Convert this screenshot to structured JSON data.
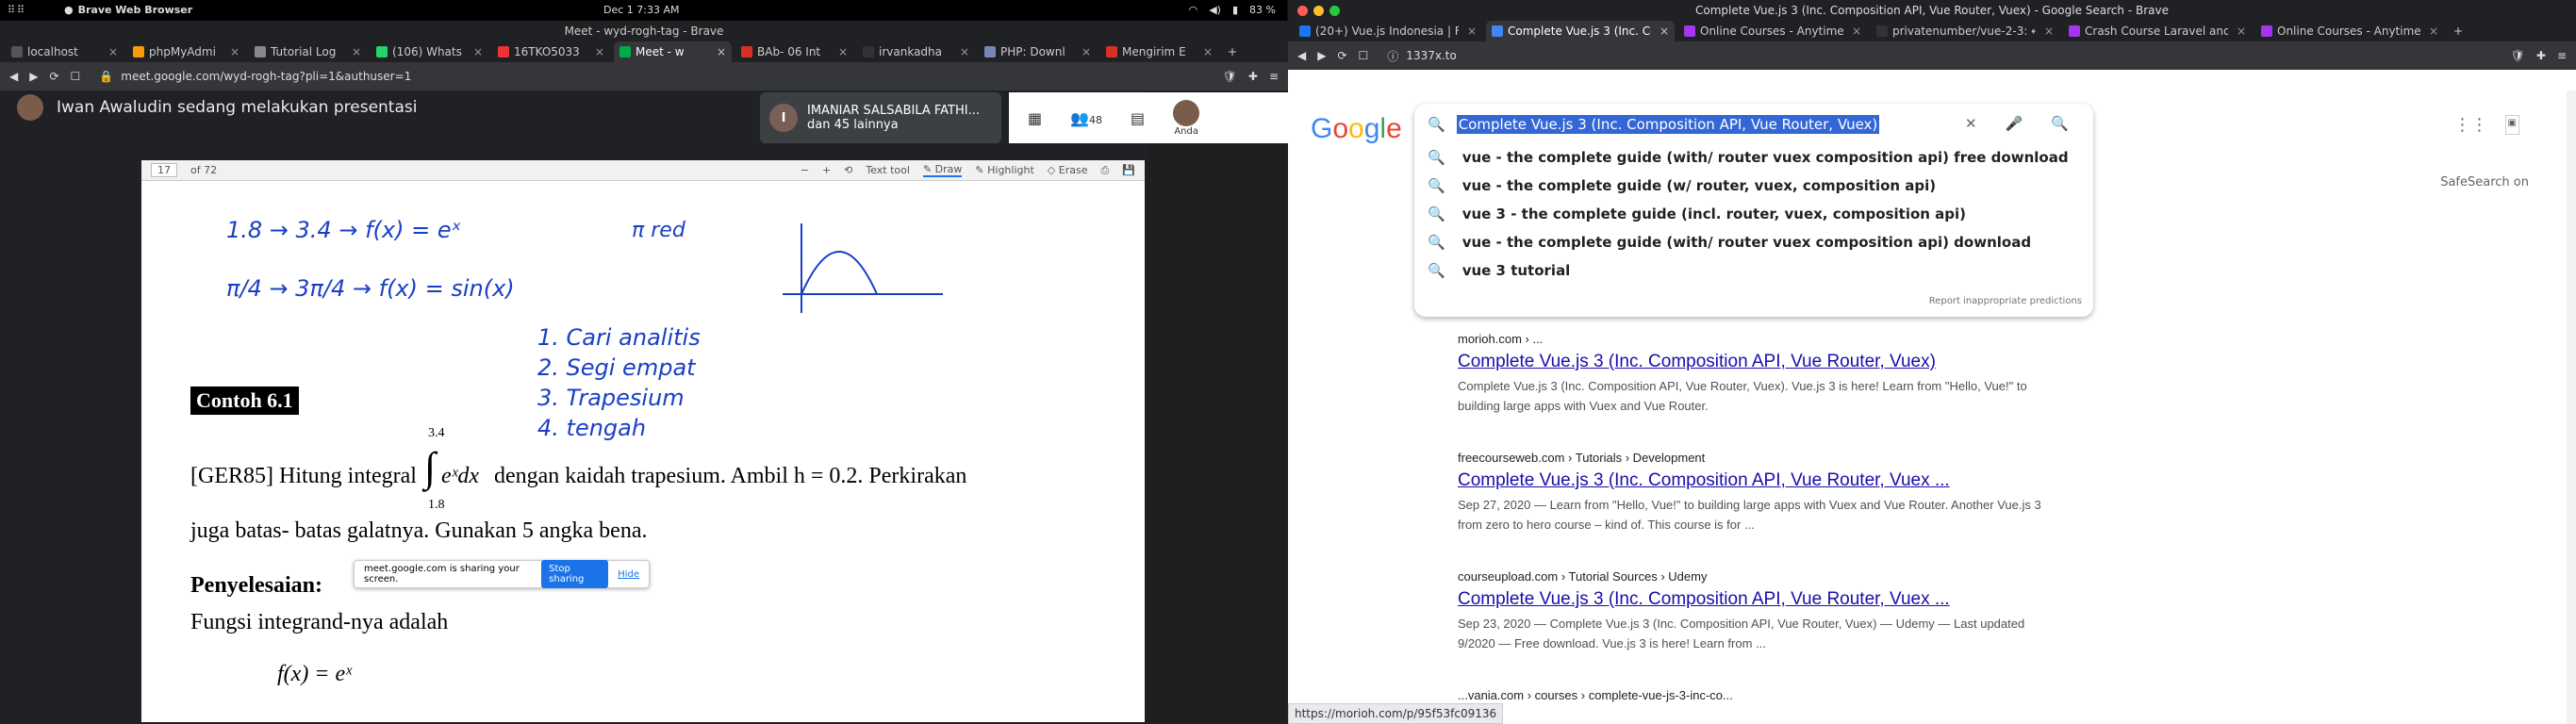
{
  "top": {
    "activities": "⠿⠿",
    "app": "Brave Web Browser",
    "clock": "Dec 1  7:33 AM",
    "battery": "83 %"
  },
  "left": {
    "title": "Meet - wyd-rogh-tag - Brave",
    "tabs": [
      {
        "label": "localhost",
        "color": "#555"
      },
      {
        "label": "phpMyAdmi",
        "color": "#f89c0e"
      },
      {
        "label": "Tutorial Log",
        "color": "#888"
      },
      {
        "label": "(106) Whats",
        "color": "#25d366"
      },
      {
        "label": "16TKO5033",
        "color": "#e33"
      },
      {
        "label": "Meet - w",
        "color": "#00ac47",
        "active": true
      },
      {
        "label": "BAb- 06 Int",
        "color": "#d93025"
      },
      {
        "label": "irvankadha",
        "color": "#333"
      },
      {
        "label": "PHP: Downl",
        "color": "#7a86b8"
      },
      {
        "label": "Mengirim E",
        "color": "#d93025"
      }
    ],
    "url": "meet.google.com/wyd-rogh-tag?pli=1&authuser=1",
    "presenter": "Iwan Awaludin sedang melakukan presentasi",
    "participant": {
      "initial": "I",
      "name": "IMANIAR SALSABILA FATHI...",
      "more": "dan 45 lainnya"
    },
    "people_count": "48",
    "you_label": "Anda",
    "pdf": {
      "page": "17",
      "of": "of 72",
      "text_tool": "Text tool",
      "draw": "Draw",
      "highlight": "Highlight",
      "erase": "Erase"
    },
    "notes": {
      "l1": "1.8 → 3.4 → f(x) = eˣ",
      "l2": "π/4 → 3π/4 → f(x) = sin(x)",
      "pi": "π red",
      "steps": [
        "1. Cari analitis",
        "2. Segi empat",
        "3. Trapesium",
        "4. tengah"
      ]
    },
    "doc": {
      "example": "Contoh 6.1",
      "line1": "[GER85] Hitung integral",
      "integral_upper": "3.4",
      "integral_lower": "1.8",
      "integrand": "eˣdx",
      "line1b": "dengan kaidah trapesium. Ambil  h =  0.2. Perkirakan",
      "line2": "juga batas- batas galatnya. Gunakan 5 angka bena.",
      "solution": "Penyelesaian:",
      "line3": "Fungsi integrand-nya adalah",
      "formula": "f(x)  =  eˣ"
    },
    "share": {
      "text": "meet.google.com is sharing your screen.",
      "stop": "Stop sharing",
      "hide": "Hide"
    }
  },
  "right": {
    "title": "Complete Vue.js 3 (Inc. Composition API, Vue Router, Vuex) - Google Search - Brave",
    "tabs": [
      {
        "label": "(20+) Vue.js Indonesia | Fa",
        "color": "#1877f2"
      },
      {
        "label": "Complete Vue.js 3 (Inc. Co",
        "color": "#4285f4",
        "active": true
      },
      {
        "label": "Online Courses - Anytime,",
        "color": "#a435f0"
      },
      {
        "label": "privatenumber/vue-2-3: ←",
        "color": "#333"
      },
      {
        "label": "Crash Course Laravel and",
        "color": "#a435f0"
      },
      {
        "label": "Online Courses - Anytime,",
        "color": "#a435f0"
      }
    ],
    "url": "1337x.to",
    "query": "Complete Vue.js 3 (Inc. Composition API, Vue Router, Vuex)",
    "suggestions": [
      "vue - the complete guide (with/ router vuex composition api) free download",
      "vue - the complete guide (w/ router, vuex, composition api)",
      "vue 3 - the complete guide (incl. router, vuex, composition api)",
      "vue - the complete guide (with/ router vuex composition api) download",
      "vue 3 tutorial"
    ],
    "report": "Report inappropriate predictions",
    "safesearch": "SafeSearch on",
    "results": [
      {
        "cite": "morioh.com › ...",
        "title": "Complete Vue.js 3 (Inc. Composition API, Vue Router, Vuex)",
        "snippet": "Complete Vue.js 3 (Inc. Composition API, Vue Router, Vuex). Vue.js 3 is here! Learn from \"Hello, Vue!\" to building large apps with Vuex and Vue Router."
      },
      {
        "cite": "freecourseweb.com › Tutorials › Development",
        "title": "Complete Vue.js 3 (Inc. Composition API, Vue Router, Vuex ...",
        "snippet": "Sep 27, 2020 — Learn from \"Hello, Vue!\" to building large apps with Vuex and Vue Router. Another Vue.js 3 from zero to hero course – kind of. This course is for ..."
      },
      {
        "cite": "courseupload.com › Tutorial Sources › Udemy",
        "title": "Complete Vue.js 3 (Inc. Composition API, Vue Router, Vuex ...",
        "snippet": "Sep 23, 2020 — Complete Vue.js 3 (Inc. Composition API, Vue Router, Vuex) — Udemy — Last updated 9/2020 — Free download. Vue.js 3 is here! Learn from ..."
      },
      {
        "cite": "...vania.com › courses › complete-vue-js-3-inc-co...",
        "title": "",
        "snippet": ""
      }
    ],
    "status_url": "https://morioh.com/p/95f53fc09136"
  }
}
